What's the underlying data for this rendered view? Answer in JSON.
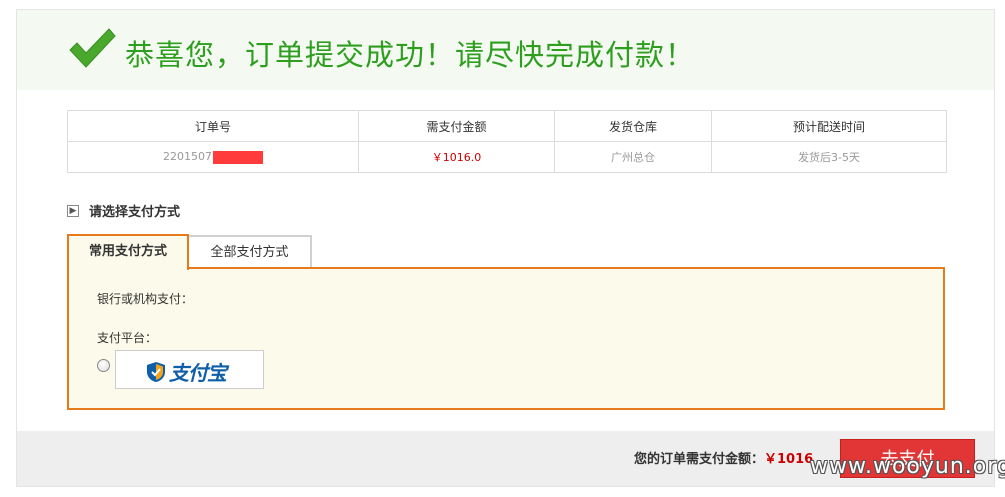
{
  "banner": {
    "title": "恭喜您，订单提交成功！请尽快完成付款！"
  },
  "order_table": {
    "headers": [
      "订单号",
      "需支付金额",
      "发货仓库",
      "预计配送时间"
    ],
    "row": {
      "order_no_prefix": "2201507",
      "amount": "￥1016.0",
      "warehouse": "广州总仓",
      "delivery": "发货后3-5天"
    }
  },
  "payment": {
    "heading": "请选择支付方式",
    "tabs": [
      "常用支付方式",
      "全部支付方式"
    ],
    "bank_label": "银行或机构支付：",
    "platform_label": "支付平台：",
    "alipay_text": "支付宝"
  },
  "footer": {
    "due_label": "您的订单需支付金额：",
    "due_amount": "￥1016",
    "pay_button": "去支付"
  },
  "watermark": "www.wooyun.org",
  "colors": {
    "success_green": "#2e9e1f",
    "accent_orange": "#e87a1e",
    "price_red": "#cc0000",
    "button_red": "#e23636"
  }
}
